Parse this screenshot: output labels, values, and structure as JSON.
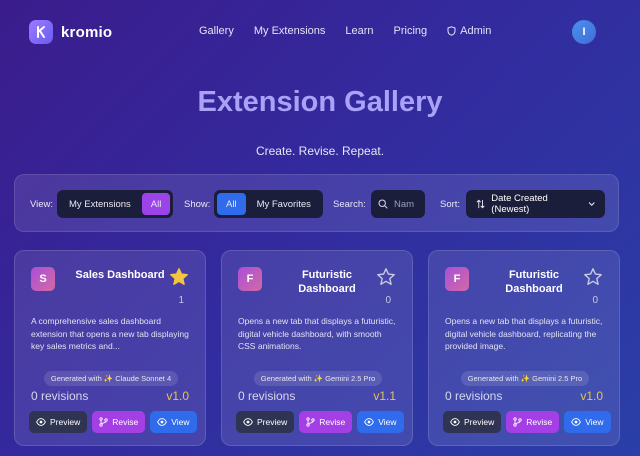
{
  "brand": {
    "name": "kromio",
    "logo_icon": "k-logo-icon"
  },
  "nav": {
    "items": [
      "Gallery",
      "My Extensions",
      "Learn",
      "Pricing",
      "Admin"
    ],
    "admin_icon": "shield-icon"
  },
  "user": {
    "avatar_initial": "I"
  },
  "hero": {
    "title": "Extension Gallery",
    "subtitle": "Create. Revise. Repeat."
  },
  "filters": {
    "view_label": "View:",
    "view_options": [
      "My Extensions",
      "All"
    ],
    "view_selected": "All",
    "show_label": "Show:",
    "show_options": [
      "All",
      "My Favorites"
    ],
    "show_selected": "All",
    "search_label": "Search:",
    "search_placeholder": "Nam",
    "sort_label": "Sort:",
    "sort_value": "Date Created (Newest)"
  },
  "cards": [
    {
      "initial": "S",
      "title": "Sales Dashboard",
      "favorited": true,
      "favorites": "1",
      "description": "A comprehensive sales dashboard extension that opens a new tab displaying key sales metrics and...",
      "generated": "Generated with ✨ Claude Sonnet 4",
      "revisions": "0 revisions",
      "version": "v1.0",
      "actions": [
        "Preview",
        "Revise",
        "View"
      ]
    },
    {
      "initial": "F",
      "title": "Futuristic Dashboard",
      "favorited": false,
      "favorites": "0",
      "description": "Opens a new tab that displays a futuristic, digital vehicle dashboard, with smooth CSS animations.",
      "generated": "Generated with ✨ Gemini 2.5 Pro",
      "revisions": "0 revisions",
      "version": "v1.1",
      "actions": [
        "Preview",
        "Revise",
        "View"
      ]
    },
    {
      "initial": "F",
      "title": "Futuristic Dashboard",
      "favorited": false,
      "favorites": "0",
      "description": "Opens a new tab that displays a futuristic, digital vehicle dashboard, replicating the provided image.",
      "generated": "Generated with ✨ Gemini 2.5 Pro",
      "revisions": "0 revisions",
      "version": "v1.0",
      "actions": [
        "Preview",
        "Revise",
        "View"
      ]
    }
  ],
  "colors": {
    "accent_purple": "#9d43ea",
    "accent_blue": "#2f6bea",
    "version_gold": "#e8c34a",
    "star_gold": "#f5c542"
  }
}
